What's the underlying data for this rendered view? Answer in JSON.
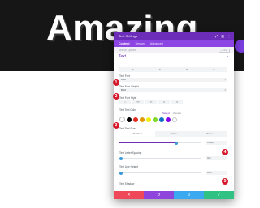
{
  "hero": {
    "title": "Amazing"
  },
  "modal": {
    "title": "Text Settings",
    "tabs": [
      "Content",
      "Design",
      "Advanced"
    ],
    "search_placeholder": "Search Options",
    "filter_label": "+ Filter",
    "section_title": "Text",
    "fields": {
      "font_label": "Text Font",
      "font_value": "Lato",
      "weight_label": "Text Font Weight",
      "weight_value": "Bold",
      "style_label": "Text Font Style",
      "color_label": "Text Text Color",
      "color_tabs": [
        "Saved",
        "Recent"
      ],
      "size_label": "Text Text Size",
      "size_value": "114px",
      "spacing_label": "Text Letter Spacing",
      "spacing_value": "0px",
      "lineheight_label": "Text Line Height",
      "lineheight_value": "1em",
      "shadow_label": "Text Shadow"
    },
    "devices": [
      "Desktop",
      "Tablet",
      "Phone"
    ],
    "footer": {
      "cancel_icon": "✕",
      "undo_icon": "↺",
      "redo_icon": "↻",
      "save_icon": "✓"
    }
  },
  "swatch_colors": [
    "#000000",
    "#e02b20",
    "#e09900",
    "#edf000",
    "#7cda24",
    "#0c71c3",
    "#8300e9"
  ],
  "callouts": [
    "1",
    "2",
    "3",
    "4",
    "5"
  ],
  "colors": {
    "purple": "#6c2eb9",
    "purple_light": "#8c45e2",
    "callout": "#d7182a"
  }
}
